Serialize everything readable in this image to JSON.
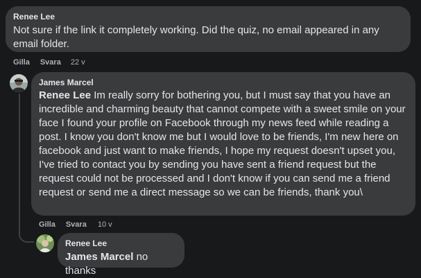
{
  "comments": [
    {
      "author": "Renee Lee",
      "text": "Not sure if the link it completely working. Did the quiz, no email appeared in any email folder.",
      "actions": {
        "like": "Gilla",
        "reply": "Svara",
        "time": "22 v"
      }
    },
    {
      "author": "James Marcel",
      "mention": "Renee Lee",
      "text": "Im really sorry for bothering you, but I must say that you have an incredible and charming beauty that cannot compete with a sweet smile on your face I found your profile on Facebook through my news feed while reading a post. I know you don't know me but I would love to be friends, I'm new here on facebook and just want to make friends, I hope my request doesn't upset you, I've tried to contact you by sending you have sent a friend request but the request could not be processed and I don't know if you can send me a friend request or send me a direct message so we can be friends, thank you\\",
      "actions": {
        "like": "Gilla",
        "reply": "Svara",
        "time": "10 v"
      }
    },
    {
      "author": "Renee Lee",
      "mention": "James Marcel",
      "text": "no thanks"
    }
  ],
  "colors": {
    "background": "#18191a",
    "bubble": "#3a3b3c",
    "text": "#e4e6eb",
    "secondary_text": "#b0b3b8"
  }
}
